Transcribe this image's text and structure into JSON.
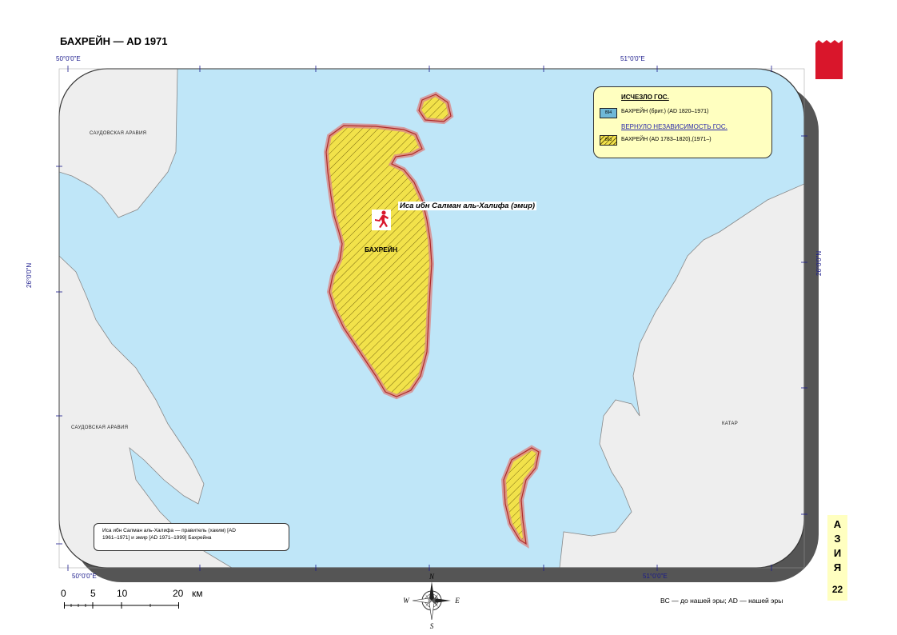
{
  "title": "БАХРЕЙН — AD 1971",
  "coordinates": {
    "top_left": "50°0'0\"E",
    "top_right": "51°0'0\"E",
    "bottom_left": "50°0'0\"E",
    "bottom_right": "51°0'0\"E",
    "left_lat": "26°0'0\"N",
    "right_lat": "26°0'0\"N"
  },
  "map": {
    "water_color": "#bfe6f8",
    "land_color": "#eeeeee",
    "bahrain_fill": "#f2e24a",
    "border_color": "#c0393b",
    "labels": {
      "saudi_1": "САУДОВСКАЯ АРАВИЯ",
      "saudi_2": "САУДОВСКАЯ АРАВИЯ",
      "qatar": "КАТАР",
      "bahrain": "БАХРЕЙН",
      "ruler": "Иса ибн Салман аль-Халифа (эмир)"
    },
    "icons": {
      "ruler": "running-figure-icon",
      "compass": "compass-rose-icon",
      "flag": "bahrain-flag-icon"
    }
  },
  "legend": {
    "title": "ИСЧЕЗЛО ГОС.",
    "item_1_code": "894",
    "item_1_text": "БАХРЕЙН (брит.) (AD 1820–1971)",
    "subtitle": "ВЕРНУЛО НЕЗАВИСИМОСТЬ ГОС.",
    "item_2_code": "893",
    "item_2_text": "БАХРЕЙН (AD 1783–1820),(1971–)"
  },
  "info": {
    "line_1": "Иса ибн Салман аль-Халифа — правитель (хаким) [AD",
    "line_2": "1961–1971] и эмир  [AD 1971–1999] Бахрейна"
  },
  "scale": {
    "n0": "0",
    "n5": "5",
    "n10": "10",
    "n20": "20",
    "unit": "км"
  },
  "side": {
    "letters": [
      "А",
      "З",
      "И",
      "Я"
    ],
    "page": "22"
  },
  "footnote": "BC — до нашей эры; AD — нашей эры"
}
